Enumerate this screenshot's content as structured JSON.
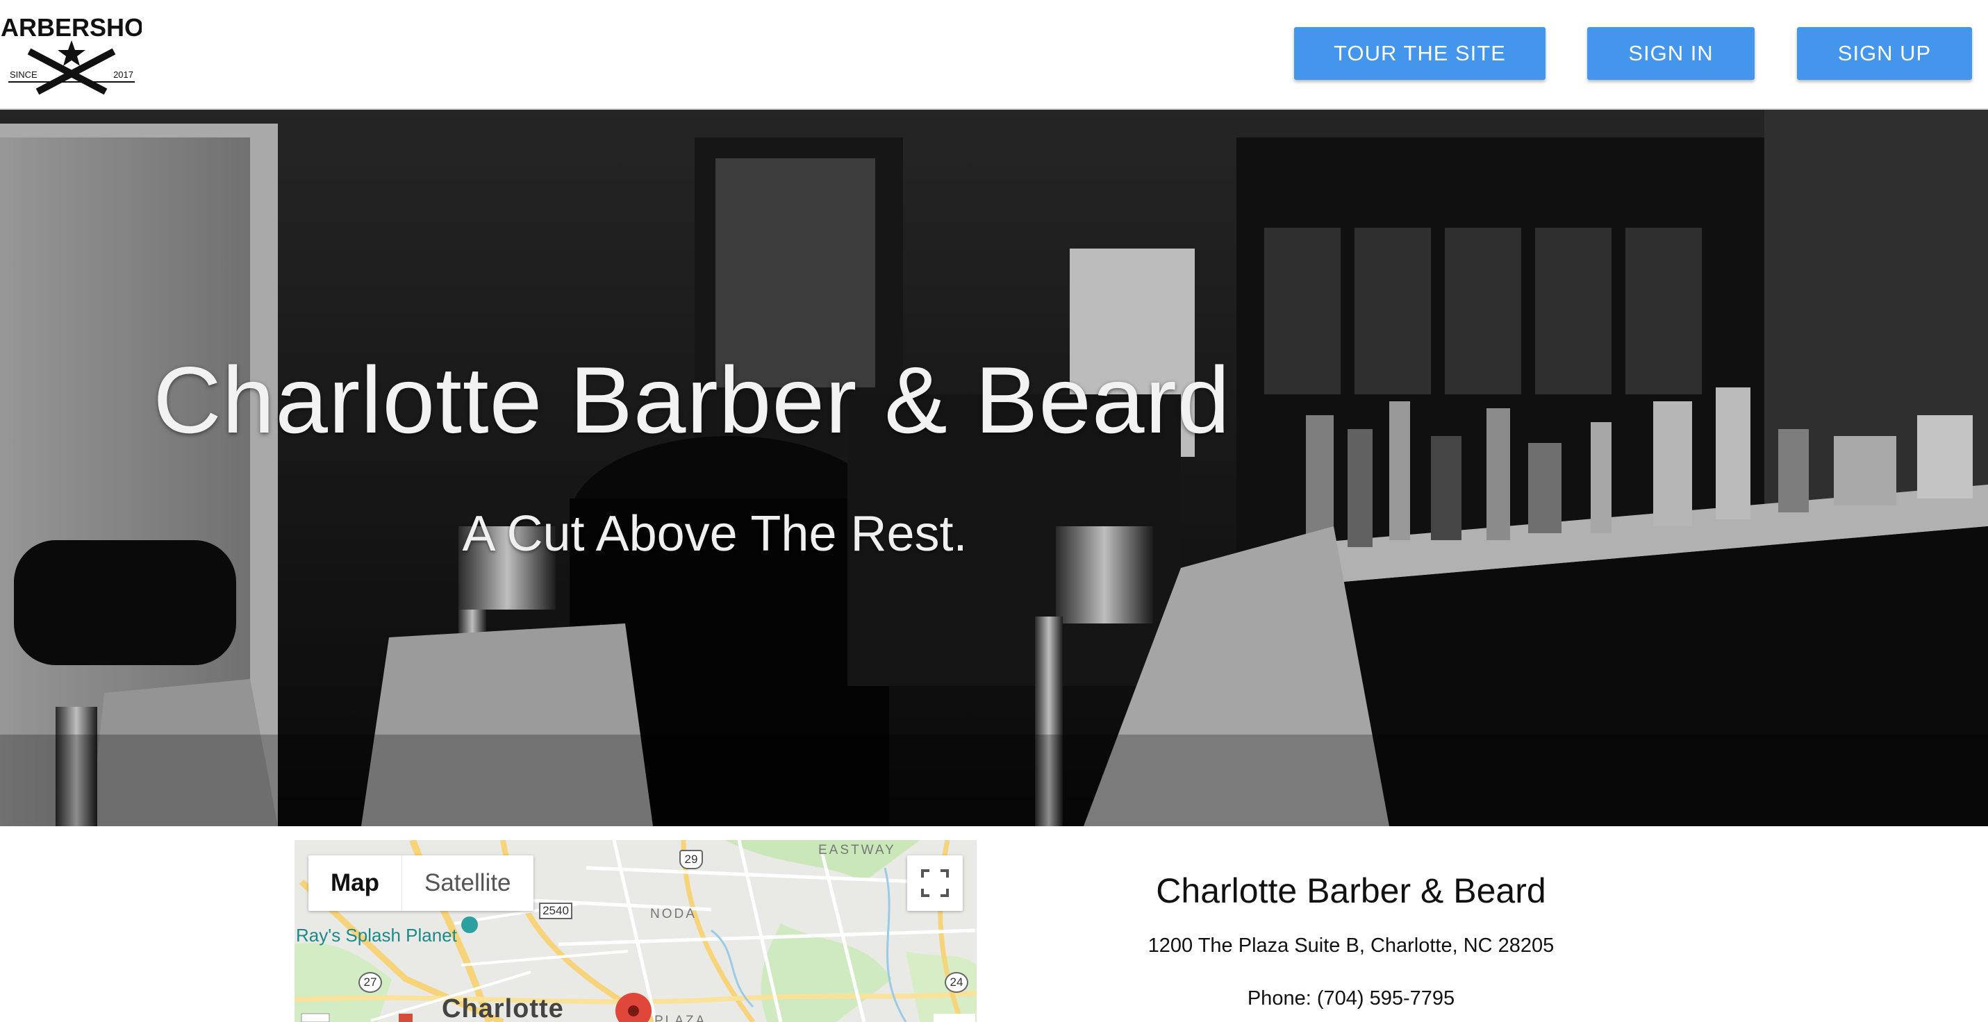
{
  "header": {
    "logo": {
      "icon": "barbershop-logo-icon",
      "top_text": "BARBERSHOP",
      "since_label": "SINCE",
      "year": "2017"
    },
    "buttons": {
      "tour": "TOUR THE SITE",
      "sign_in": "SIGN IN",
      "sign_up": "SIGN UP"
    },
    "accent_color": "#4396ec"
  },
  "hero": {
    "title": "Charlotte Barber & Beard",
    "subtitle": "A Cut Above The Rest."
  },
  "map": {
    "tabs": {
      "map": "Map",
      "satellite": "Satellite"
    },
    "labels": {
      "splash": "Ray's Splash Planet",
      "city": "Charlotte",
      "noda": "NODA",
      "eastway": "EASTWAY",
      "plaza": "PLAZA"
    },
    "shields": [
      "29",
      "2540",
      "27",
      "24"
    ],
    "fullscreen_icon": "fullscreen-icon",
    "marker_icon": "map-marker-icon"
  },
  "info": {
    "name": "Charlotte Barber & Beard",
    "address": "1200 The Plaza Suite B, Charlotte, NC 28205",
    "phone": "Phone: (704) 595-7795"
  }
}
